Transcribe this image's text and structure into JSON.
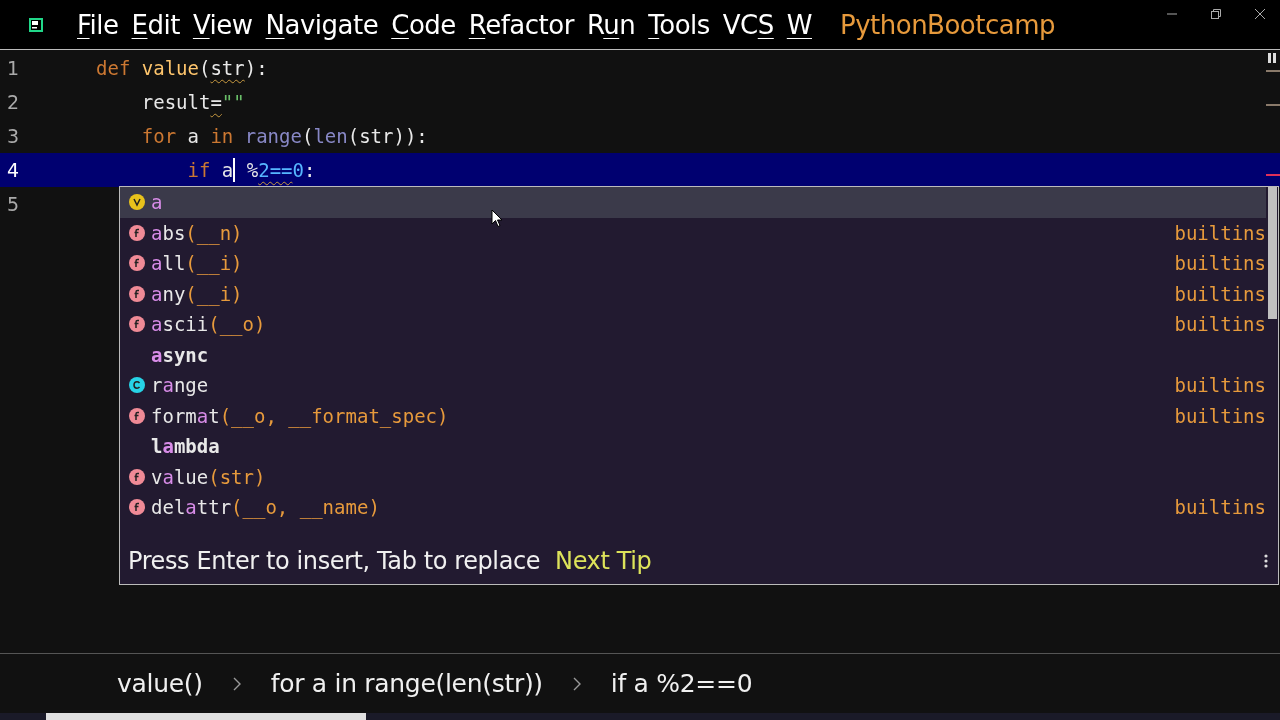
{
  "window": {
    "menu": [
      {
        "key": "F",
        "after": "ile"
      },
      {
        "key": "E",
        "after": "dit"
      },
      {
        "key": "V",
        "after": "iew"
      },
      {
        "key": "N",
        "after": "avigate"
      },
      {
        "key": "C",
        "after": "ode"
      },
      {
        "key": "R",
        "after": "efactor"
      },
      {
        "before": "R",
        "key": "u",
        "after": "n"
      },
      {
        "key": "T",
        "after": "ools"
      },
      {
        "before": "VC",
        "key": "S"
      },
      {
        "key": "W"
      }
    ],
    "project": "PythonBootcamp"
  },
  "editor": {
    "lines": [
      {
        "number": "1",
        "selected": false,
        "tokens": [
          {
            "text": "def ",
            "kind": "keyword"
          },
          {
            "text": "value",
            "kind": "function"
          },
          {
            "text": "(",
            "kind": "plain"
          },
          {
            "text": "str",
            "kind": "plain",
            "warning": true
          },
          {
            "text": "):",
            "kind": "plain"
          }
        ]
      },
      {
        "number": "2",
        "selected": false,
        "tokens": [
          {
            "text": "    result",
            "kind": "plain"
          },
          {
            "text": "=",
            "kind": "plain",
            "warning": true
          },
          {
            "text": "\"\"",
            "kind": "string"
          }
        ]
      },
      {
        "number": "3",
        "selected": false,
        "tokens": [
          {
            "text": "    for ",
            "kind": "keyword"
          },
          {
            "text": "a ",
            "kind": "plain"
          },
          {
            "text": "in ",
            "kind": "keyword"
          },
          {
            "text": "range",
            "kind": "builtin"
          },
          {
            "text": "(",
            "kind": "plain"
          },
          {
            "text": "len",
            "kind": "builtin"
          },
          {
            "text": "(str)):",
            "kind": "plain"
          }
        ]
      },
      {
        "number": "4",
        "selected": true,
        "tokens": [
          {
            "text": "        if ",
            "kind": "keyword"
          },
          {
            "text": "a",
            "kind": "plain"
          },
          {
            "kind": "caret"
          },
          {
            "text": " %",
            "kind": "plain"
          },
          {
            "text": "2==",
            "kind": "number",
            "warning": true
          },
          {
            "text": "0",
            "kind": "number"
          },
          {
            "text": ":",
            "kind": "plain"
          }
        ]
      },
      {
        "number": "5",
        "selected": false
      }
    ]
  },
  "completion": {
    "items": [
      {
        "kind": "variable",
        "match": "a",
        "selected": true
      },
      {
        "kind": "function",
        "match": "a",
        "after": "bs",
        "params": "(__n)",
        "source": "builtins",
        "selected": false
      },
      {
        "kind": "function",
        "match": "a",
        "after": "ll",
        "params": "(__i)",
        "source": "builtins",
        "selected": false
      },
      {
        "kind": "function",
        "match": "a",
        "after": "ny",
        "params": "(__i)",
        "source": "builtins",
        "selected": false
      },
      {
        "kind": "function",
        "match": "a",
        "after": "scii",
        "params": "(__o)",
        "source": "builtins",
        "selected": false
      },
      {
        "kind": "keyword",
        "match": "a",
        "after": "sync",
        "selected": false
      },
      {
        "kind": "class",
        "before": "r",
        "match": "a",
        "after": "nge",
        "source": "builtins",
        "selected": false
      },
      {
        "kind": "function",
        "before": "form",
        "match": "a",
        "after": "t",
        "params": "(__o, __format_spec)",
        "source": "builtins",
        "selected": false
      },
      {
        "kind": "keyword",
        "before": "l",
        "match": "a",
        "after": "mbda",
        "selected": false
      },
      {
        "kind": "function",
        "before": "v",
        "match": "a",
        "after": "lue",
        "params": "(str)",
        "selected": false
      },
      {
        "kind": "function",
        "before": "del",
        "match": "a",
        "after": "ttr",
        "params": "(__o, __name)",
        "source": "builtins",
        "selected": false
      }
    ],
    "hint": "Press Enter to insert, Tab to replace",
    "tip_link": "Next Tip"
  },
  "breadcrumbs": [
    "value()",
    "for a in range(len(str))",
    "if a %2==0"
  ]
}
